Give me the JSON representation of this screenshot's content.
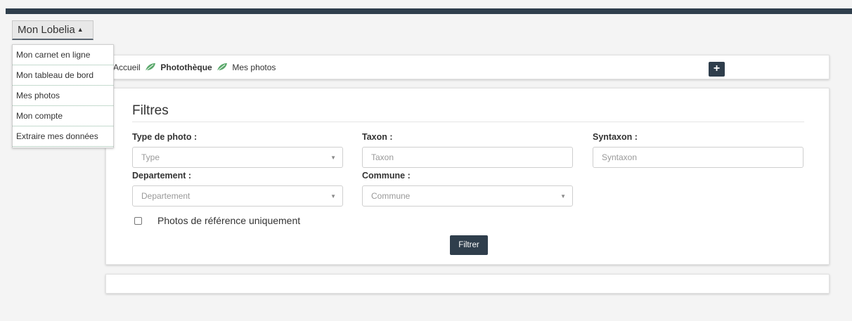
{
  "menu": {
    "button_label": "Mon Lobelia",
    "items": [
      {
        "label": "Mon carnet en ligne"
      },
      {
        "label": "Mon tableau de bord"
      },
      {
        "label": "Mes photos"
      },
      {
        "label": "Mon compte"
      },
      {
        "label": "Extraire mes données"
      }
    ]
  },
  "breadcrumb": {
    "items": [
      "Accueil",
      "Photothèque",
      "Mes photos"
    ]
  },
  "actions": {
    "add_label": "+"
  },
  "filters": {
    "title": "Filtres",
    "type_label": "Type de photo :",
    "type_placeholder": "Type",
    "taxon_label": "Taxon :",
    "taxon_placeholder": "Taxon",
    "syntaxon_label": "Syntaxon :",
    "syntaxon_placeholder": "Syntaxon",
    "departement_label": "Departement :",
    "departement_placeholder": "Departement",
    "commune_label": "Commune :",
    "commune_placeholder": "Commune",
    "reference_only_label": "Photos de référence uniquement",
    "reference_only_checked": false,
    "submit_label": "Filtrer"
  },
  "colors": {
    "accent": "#2f3e4c",
    "leaf": "#5aa86b"
  }
}
